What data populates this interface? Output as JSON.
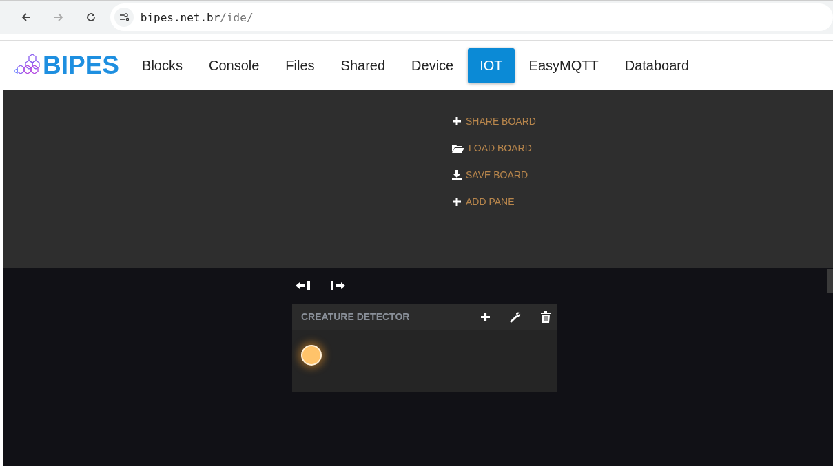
{
  "browser": {
    "url_host": "bipes.net.br",
    "url_path": "/ide/"
  },
  "app": {
    "logo": "BIPES",
    "tabs": [
      {
        "label": "Blocks",
        "selected": false
      },
      {
        "label": "Console",
        "selected": false
      },
      {
        "label": "Files",
        "selected": false
      },
      {
        "label": "Shared",
        "selected": false
      },
      {
        "label": "Device",
        "selected": false
      },
      {
        "label": "IOT",
        "selected": true
      },
      {
        "label": "EasyMQTT",
        "selected": false
      },
      {
        "label": "Databoard",
        "selected": false
      }
    ]
  },
  "board_menu": [
    {
      "kind": "plus",
      "label": "SHARE BOARD"
    },
    {
      "kind": "folder",
      "label": "LOAD BOARD"
    },
    {
      "kind": "save",
      "label": "SAVE BOARD"
    },
    {
      "kind": "plus",
      "label": "ADD PANE"
    }
  ],
  "pane": {
    "title": "CREATURE DETECTOR",
    "indicator": {
      "lit": true
    }
  }
}
